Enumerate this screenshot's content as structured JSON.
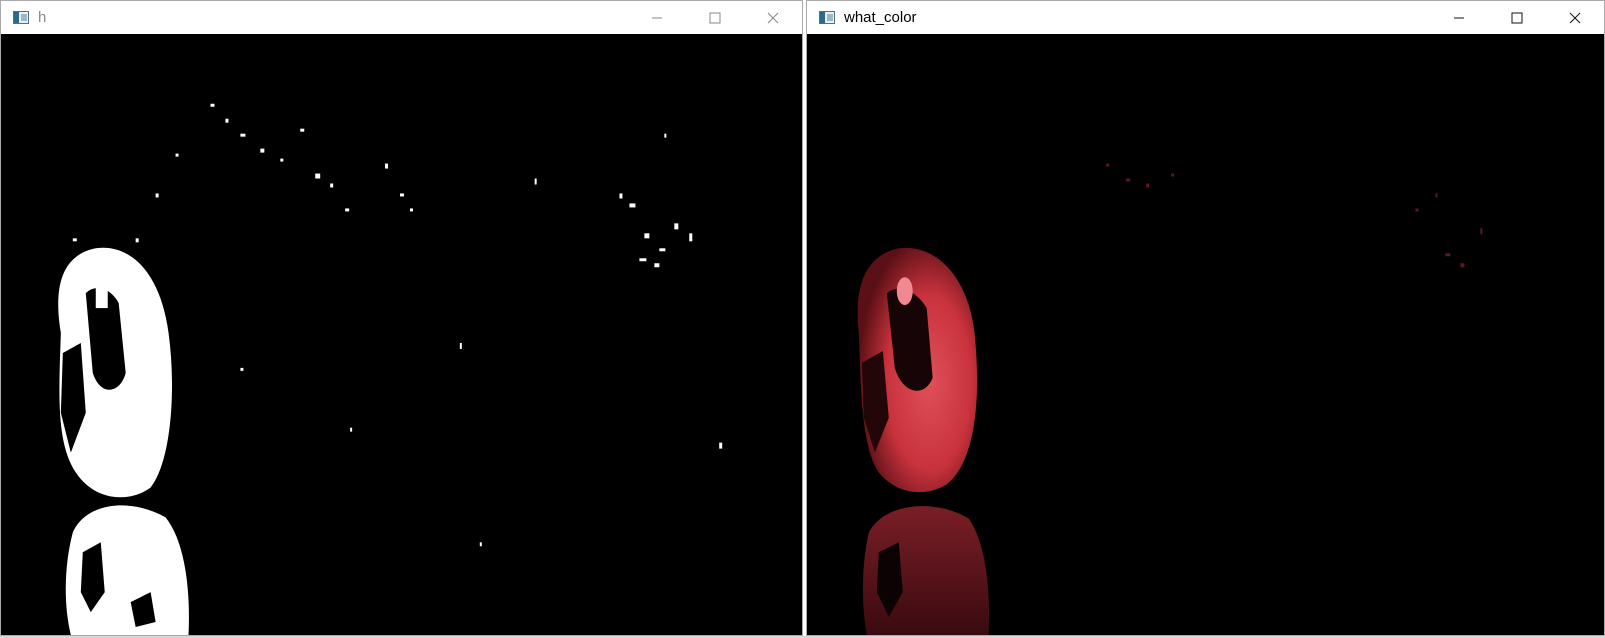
{
  "windows": [
    {
      "id": "h",
      "title": "h",
      "active": false,
      "icon": "opencv-window-icon",
      "controls": [
        "minimize-icon",
        "maximize-icon",
        "close-icon"
      ],
      "image": "binary-mask-of-red-egg"
    },
    {
      "id": "what_color",
      "title": "what_color",
      "active": true,
      "icon": "opencv-window-icon",
      "controls": [
        "minimize-icon",
        "maximize-icon",
        "close-icon"
      ],
      "image": "masked-red-egg-on-black"
    }
  ],
  "colors": {
    "mask_fg": "#ffffff",
    "mask_bg": "#000000",
    "egg_red": "#d43a44",
    "egg_highlight": "#f08a90"
  }
}
